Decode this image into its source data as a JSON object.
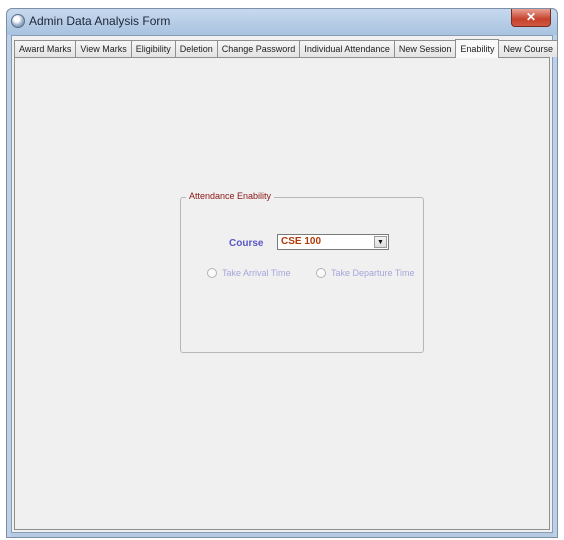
{
  "window": {
    "title": "Admin Data Analysis Form",
    "close_symbol": "✕",
    "app_icon": "app-icon",
    "colors": {
      "titlebar": "#bcd0e8",
      "close_button": "#c6412b",
      "group_title": "#8a1616",
      "course_label": "#5a57c7",
      "course_value": "#b03a0a",
      "disabled_radio_text": "#a6a6dc"
    }
  },
  "tabs": [
    {
      "label": "Award Marks"
    },
    {
      "label": "View Marks"
    },
    {
      "label": "Eligibility"
    },
    {
      "label": "Deletion"
    },
    {
      "label": "Change Password"
    },
    {
      "label": "Individual Attendance"
    },
    {
      "label": "New Session"
    },
    {
      "label": "Enability"
    },
    {
      "label": "New Course"
    }
  ],
  "active_tab": "Enability",
  "group": {
    "title": "Attendance Enability",
    "course_label": "Course",
    "course_value": "CSE 100",
    "dropdown_icon": "chevron-down-icon",
    "radio_arrival": "Take Arrival Time",
    "radio_departure": "Take Departure Time"
  }
}
